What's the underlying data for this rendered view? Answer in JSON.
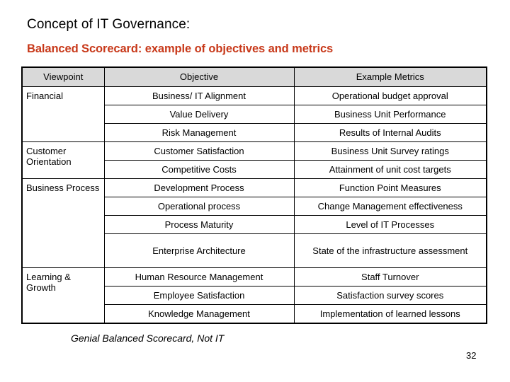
{
  "slide": {
    "title": "Concept of IT Governance:",
    "subtitle": "Balanced Scorecard: example of objectives and metrics",
    "subtitle_color": "#C8391A",
    "footnote": "Genial Balanced Scorecard, Not IT",
    "page_number": "32"
  },
  "table": {
    "header": {
      "viewpoint": "Viewpoint",
      "objective": "Objective",
      "metrics": "Example Metrics"
    },
    "header_background": "#D9D9D9",
    "rows": [
      {
        "viewpoint": "",
        "objective": "Business/ IT Alignment",
        "metric": "Operational budget approval"
      },
      {
        "viewpoint": "Financial",
        "objective": "Value Delivery",
        "metric": "Business Unit Performance"
      },
      {
        "viewpoint": "",
        "objective": "Risk Management",
        "metric": "Results of Internal Audits"
      },
      {
        "viewpoint": "Customer Orientation",
        "objective": "Customer Satisfaction",
        "metric": "Business Unit Survey ratings"
      },
      {
        "viewpoint": "",
        "objective": "Competitive Costs",
        "metric": "Attainment of unit cost targets"
      },
      {
        "viewpoint": "Business Process",
        "objective": "Development Process",
        "metric": "Function Point Measures"
      },
      {
        "viewpoint": "",
        "objective": "Operational process",
        "metric": "Change Management effectiveness"
      },
      {
        "viewpoint": "",
        "objective": "Process Maturity",
        "metric": "Level of IT Processes"
      },
      {
        "viewpoint": "",
        "objective": "Enterprise Architecture",
        "metric": "State of the infrastructure assessment"
      },
      {
        "viewpoint": "Learning & Growth",
        "objective": "Human Resource Management",
        "metric": "Staff Turnover"
      },
      {
        "viewpoint": "",
        "objective": "Employee Satisfaction",
        "metric": "Satisfaction survey scores"
      },
      {
        "viewpoint": "",
        "objective": "Knowledge Management",
        "metric": "Implementation of learned lessons"
      }
    ]
  }
}
